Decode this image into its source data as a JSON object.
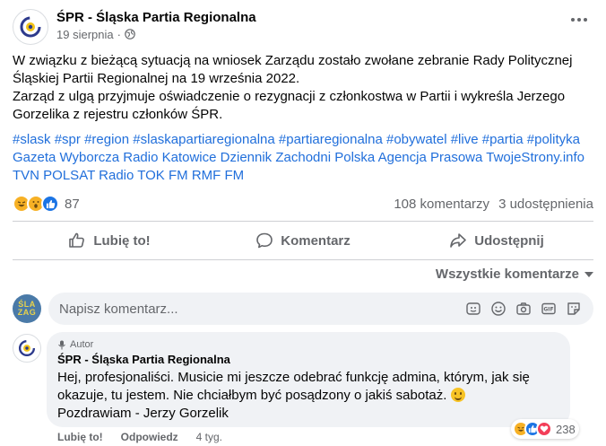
{
  "post": {
    "page_name": "ŚPR - Śląska Partia Regionalna",
    "date": "19 sierpnia",
    "separator": "·",
    "audience_icon": "globe-icon",
    "body_line1": "W związku z bieżącą sytuacją na wniosek Zarządu zostało zwołane zebranie Rady Politycznej Śląskiej Partii Regionalnej na 19 września 2022.",
    "body_line2": "Zarząd z ulgą przyjmuje oświadczenie o rezygnacji z członkostwa w Partii i wykreśla Jerzego Gorzelika z rejestru członków ŚPR.",
    "tags": [
      "#slask",
      "#spr",
      "#region",
      "#slaskapartiaregionalna",
      "#partiaregionalna",
      "#obywatel",
      "#live",
      "#partia",
      "#polityka",
      "Gazeta Wyborcza",
      "Radio Katowice",
      "Dziennik Zachodni",
      "Polska Agencja Prasowa",
      "TwojeStrony.info",
      "TVN",
      "POLSAT",
      "Radio TOK FM",
      "RMF FM"
    ],
    "reaction_count": "87",
    "comments_count": "108 komentarzy",
    "shares_count": "3 udostępnienia"
  },
  "actions": {
    "like": "Lubię to!",
    "comment": "Komentarz",
    "share": "Udostępnij"
  },
  "sort_label": "Wszystkie komentarze",
  "composer": {
    "avatar_text": "ŚLA ZAG",
    "placeholder": "Napisz komentarz..."
  },
  "comment": {
    "badge": "Autor",
    "author": "ŚPR - Śląska Partia Regionalna",
    "line1": "Hej, profesjonaliści. Musicie mi jeszcze odebrać funkcję admina, którym, jak się okazuje, tu jestem. Nie chciałbym być posądzony o jakiś sabotaż.",
    "line2": "Pozdrawiam - Jerzy Gorzelik",
    "reaction_count": "238",
    "like": "Lubię to!",
    "reply": "Odpowiedz",
    "time": "4 tyg."
  },
  "colors": {
    "link": "#216fdb",
    "muted": "#65676b",
    "bubble": "#f0f2f5"
  }
}
